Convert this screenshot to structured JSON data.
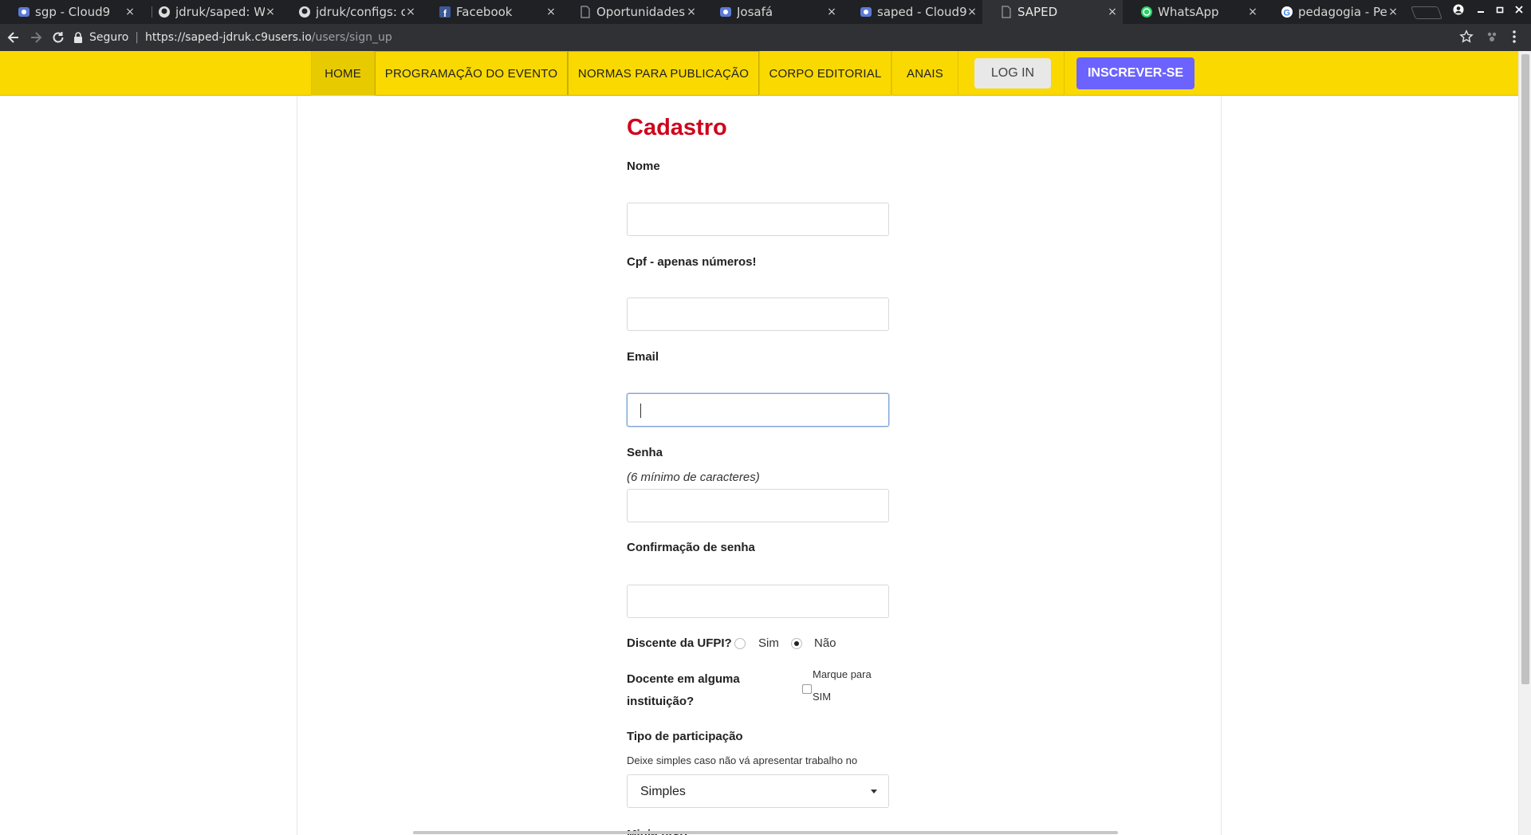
{
  "browser": {
    "tabs": [
      {
        "title": "sgp - Cloud9",
        "icon": "cloud9-icon"
      },
      {
        "title": "jdruk/saped: Web",
        "icon": "github-icon"
      },
      {
        "title": "jdruk/configs: cor",
        "icon": "github-icon"
      },
      {
        "title": "Facebook",
        "icon": "facebook-icon"
      },
      {
        "title": "Oportunidades - I",
        "icon": "document-icon"
      },
      {
        "title": "Josafá",
        "icon": "cloud9-icon"
      },
      {
        "title": "saped - Cloud9",
        "icon": "cloud9-icon"
      },
      {
        "title": "SAPED",
        "icon": "document-icon"
      },
      {
        "title": "WhatsApp",
        "icon": "whatsapp-icon"
      },
      {
        "title": "pedagogia - Pes",
        "icon": "google-icon"
      }
    ],
    "close_glyph": "×",
    "address": {
      "secure_label": "Seguro",
      "separator": "|",
      "host": "https://saped-jdruk.c9users.io",
      "path": "/users/sign_up"
    }
  },
  "nav": {
    "items": [
      {
        "label": "HOME"
      },
      {
        "label": "PROGRAMAÇÃO DO EVENTO"
      },
      {
        "label": "NORMAS PARA PUBLICAÇÃO"
      },
      {
        "label": "CORPO EDITORIAL"
      },
      {
        "label": "ANAIS"
      }
    ],
    "login_label": "LOG IN",
    "signup_label": "INSCREVER-SE",
    "colors": {
      "bar": "#f9d900",
      "signup": "#6c63ff",
      "title": "#d0021b"
    }
  },
  "form": {
    "title": "Cadastro",
    "name_label": "Nome",
    "cpf_label": "Cpf - apenas números!",
    "email_label": "Email",
    "password_label": "Senha",
    "password_hint": "(6 mínimo de caracteres)",
    "password_confirm_label": "Confirmação de senha",
    "student_label": "Discente da UFPI?",
    "student_yes": "Sim",
    "student_no": "Não",
    "student_selected": "Não",
    "teacher_label_line1": "Docente em alguma",
    "teacher_label_line2": "instituição?",
    "teacher_check_line1": "Marque para",
    "teacher_check_line2": "SIM",
    "participation_label": "Tipo de participação",
    "participation_hint": "Deixe simples caso não vá apresentar trabalho no evento",
    "participation_value": "Simples",
    "minicourse_label": "Mini-curso"
  }
}
